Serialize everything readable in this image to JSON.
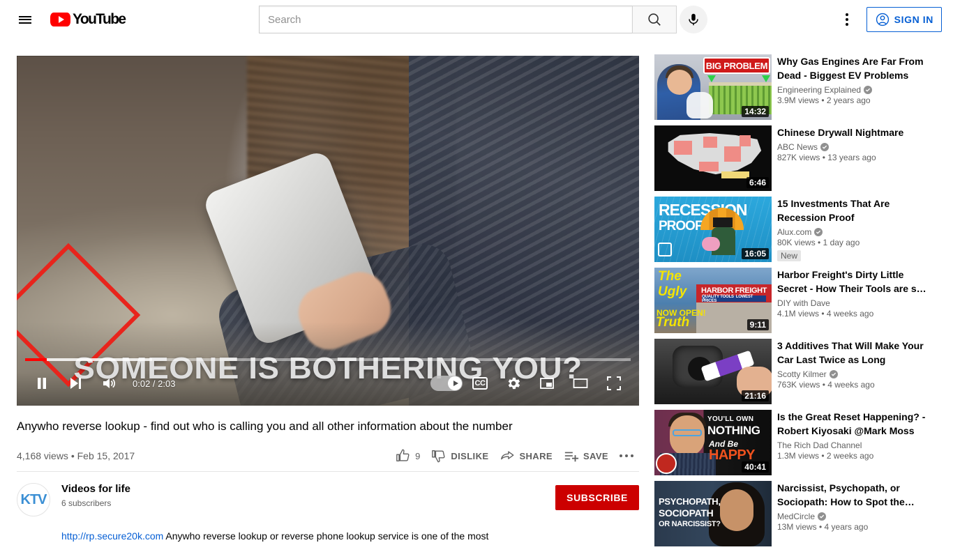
{
  "masthead": {
    "guide_label": "Guide",
    "logo_text": "YouTube",
    "search": {
      "value": "",
      "placeholder": "Search",
      "submit_label": "Search",
      "mic_label": "Search with your voice"
    },
    "settings_label": "Settings",
    "signin_label": "SIGN IN"
  },
  "player": {
    "caption_overlay": "SOMEONE IS BOTHERING YOU?",
    "time_display": "0:02 / 2:03",
    "current_time": "0:02",
    "duration": "2:03",
    "progress_percent": 3.6,
    "buffered_percent": 21,
    "controls": {
      "pause_label": "Pause",
      "next_label": "Next",
      "mute_label": "Mute",
      "autoplay_label": "Autoplay",
      "subtitles_label": "CC",
      "settings_label": "Settings",
      "miniplayer_label": "Miniplayer",
      "theater_label": "Theater mode",
      "fullscreen_label": "Full screen"
    }
  },
  "video": {
    "title": "Anywho reverse lookup - find out who is calling you and all other information about the number",
    "views": "4,168 views",
    "separator": "•",
    "date": "Feb 15, 2017",
    "actions": {
      "like_count": "9",
      "like_label": "LIKE",
      "dislike_label": "DISLIKE",
      "share_label": "SHARE",
      "save_label": "SAVE",
      "more_label": "More actions"
    }
  },
  "channel": {
    "avatar_text": "KTV",
    "name": "Videos for life",
    "subscribers": "6 subscribers",
    "subscribe_label": "SUBSCRIBE",
    "description_link": "http://rp.secure20k.com",
    "description_text": " Anywho reverse lookup or reverse phone lookup service is one of the most"
  },
  "related": [
    {
      "title": "Why Gas Engines Are Far From Dead - Biggest EV Problems",
      "channel": "Engineering Explained",
      "verified": true,
      "stats": "3.9M views • 2 years ago",
      "duration": "14:32",
      "badge": "",
      "thumb_class": "t1",
      "thumb_text": "BIG PROBLEM"
    },
    {
      "title": "Chinese Drywall Nightmare",
      "channel": "ABC News",
      "verified": true,
      "stats": "827K views • 13 years ago",
      "duration": "6:46",
      "badge": "",
      "thumb_class": "t2",
      "thumb_text": ""
    },
    {
      "title": "15 Investments That Are Recession Proof",
      "channel": "Alux.com",
      "verified": true,
      "stats": "80K views • 1 day ago",
      "duration": "16:05",
      "badge": "New",
      "thumb_class": "t3",
      "thumb_text": "RECESSION PROOF"
    },
    {
      "title": "Harbor Freight's Dirty Little Secret - How Their Tools are s…",
      "channel": "DIY with Dave",
      "verified": false,
      "stats": "4.1M views • 4 weeks ago",
      "duration": "9:11",
      "badge": "",
      "thumb_class": "t4",
      "thumb_text": "The Ugly Truth"
    },
    {
      "title": "3 Additives That Will Make Your Car Last Twice as Long",
      "channel": "Scotty Kilmer",
      "verified": true,
      "stats": "763K views • 4 weeks ago",
      "duration": "21:16",
      "badge": "",
      "thumb_class": "t5",
      "thumb_text": ""
    },
    {
      "title": "Is the Great Reset Happening? - Robert Kiyosaki @Mark Moss",
      "channel": "The Rich Dad Channel",
      "verified": false,
      "stats": "1.3M views • 2 weeks ago",
      "duration": "40:41",
      "badge": "",
      "thumb_class": "t6",
      "thumb_text": "YOU'LL OWN NOTHING And Be HAPPY"
    },
    {
      "title": "Narcissist, Psychopath, or Sociopath: How to Spot the…",
      "channel": "MedCircle",
      "verified": true,
      "stats": "13M views • 4 years ago",
      "duration": "",
      "badge": "",
      "thumb_class": "t7",
      "thumb_text": "PSYCHOPATH, SOCIOPATH OR NARCISSIST?"
    }
  ],
  "colors": {
    "brand_red": "#ff0000",
    "subscribe_red": "#cc0000",
    "link_blue": "#065fd4",
    "annotation_red": "#e8241c",
    "text_secondary": "#606060"
  }
}
